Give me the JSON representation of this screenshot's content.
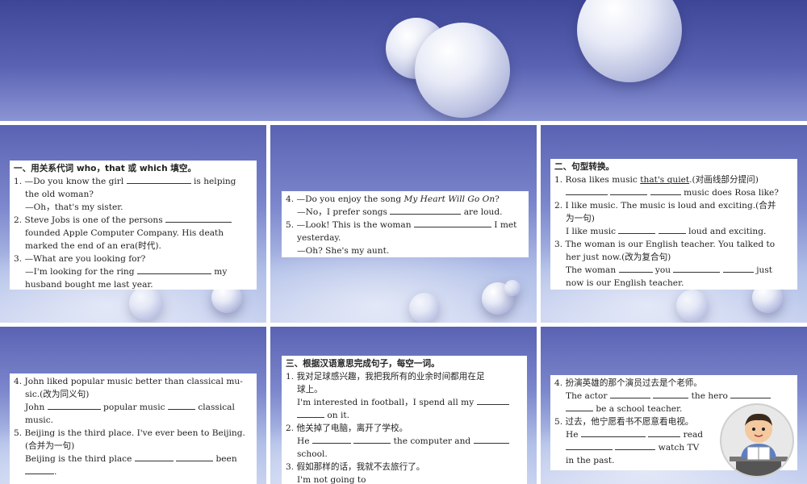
{
  "slide1": {
    "heading": "一、用关系代词 who，that 或 which 填空。",
    "q1a": "1. —Do you know the girl",
    "q1b": "is helping",
    "q1c": "the old woman?",
    "q1d": "—Oh，that's my sister.",
    "q2a": "2. Steve Jobs is one of the persons",
    "q2b": "founded Apple Computer Company. His death",
    "q2c": "marked the end of an era(时代).",
    "q3a": "3. —What are you looking for?",
    "q3b": "—I'm looking for the ring",
    "q3c": "my",
    "q3d": "husband bought me last year."
  },
  "slide2": {
    "q4a": "4. —Do you enjoy the song",
    "q4song": "My Heart Will Go On",
    "q4q": "?",
    "q4b": "—No，I prefer songs",
    "q4c": "are loud.",
    "q5a": "5. —Look! This is the woman",
    "q5b": "I met",
    "q5c": "yesterday.",
    "q5d": "—Oh? She's my aunt."
  },
  "slide3": {
    "heading": "二、句型转换。",
    "q1a": "1. Rosa likes music",
    "q1u": "that's quiet",
    "q1b": ".(对画线部分提问)",
    "q1c": "music does Rosa like?",
    "q2a": "2. I like music. The music is loud and exciting.(合并",
    "q2b": "为一句)",
    "q2c": "I like music",
    "q2d": "loud and exciting.",
    "q3a": "3. The woman is our English teacher. You talked to",
    "q3b": "her just now.(改为复合句)",
    "q3c": "The woman",
    "q3d": "you",
    "q3e": "just",
    "q3f": "now is our English teacher."
  },
  "slide4": {
    "q4a": "4. John liked popular music better than classical mu-",
    "q4b": "sic.(改为同义句)",
    "q4c": "John",
    "q4d": "popular music",
    "q4e": "classical",
    "q4f": "music.",
    "q5a": "5. Beijing is the third place. I've ever been to Beijing.",
    "q5b": "(合并为一句)",
    "q5c": "Beijing is the third place",
    "q5d": "been",
    "q5e": "."
  },
  "slide5": {
    "heading": "三、根据汉语意思完成句子，每空一词。",
    "q1a": "1. 我对足球感兴趣，我把我所有的业余时间都用在足",
    "q1b": "球上。",
    "q1c": "I'm interested in football，I spend all my",
    "q1d": "on it.",
    "q2a": "2. 他关掉了电脑，离开了学校。",
    "q2b": "He",
    "q2c": "the computer and",
    "q2d": "school.",
    "q3a": "3. 假如那样的话，我就不去旅行了。",
    "q3b": "I'm not going to"
  },
  "slide6": {
    "q4a": "4. 扮演英雄的那个演员过去是个老师。",
    "q4b": "The actor",
    "q4c": "the hero",
    "q4d": "be a school teacher.",
    "q5a": "5. 过去，他宁愿看书不愿意看电视。",
    "q5b": "He",
    "q5c": "read",
    "q5d": "watch TV",
    "q5e": "in the past."
  }
}
